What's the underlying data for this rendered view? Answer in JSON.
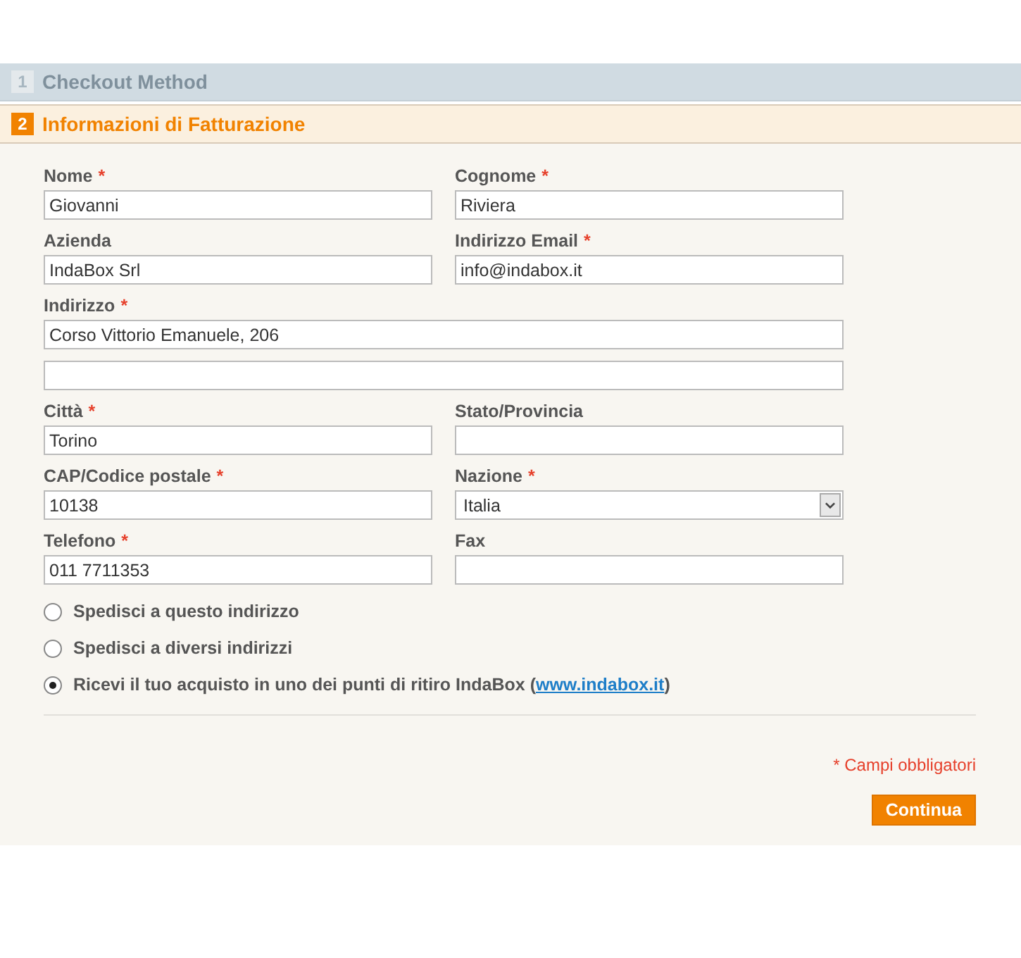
{
  "steps": [
    {
      "number": "1",
      "title": "Checkout Method",
      "selected": false
    },
    {
      "number": "2",
      "title": "Informazioni di Fatturazione",
      "selected": true
    }
  ],
  "form": {
    "rows": [
      [
        {
          "kind": "text",
          "label": "Nome",
          "required_mark": "*",
          "value": "Giovanni"
        },
        {
          "kind": "text",
          "label": "Cognome",
          "required_mark": "*",
          "value": "Riviera"
        }
      ],
      [
        {
          "kind": "text",
          "label": "Azienda",
          "value": "IndaBox Srl"
        },
        {
          "kind": "text",
          "label": "Indirizzo Email",
          "required_mark": "*",
          "value": "info@indabox.it"
        }
      ],
      [
        {
          "kind": "text",
          "label": "Indirizzo",
          "required_mark": "*",
          "value": "Corso Vittorio Emanuele, 206"
        }
      ],
      [
        {
          "kind": "text"
        }
      ],
      [
        {
          "kind": "text",
          "label": "Città",
          "required_mark": "*",
          "value": "Torino"
        },
        {
          "kind": "text",
          "label": "Stato/Provincia"
        }
      ],
      [
        {
          "kind": "text",
          "label": "CAP/Codice postale",
          "required_mark": "*",
          "value": "10138"
        },
        {
          "kind": "select",
          "label": "Nazione",
          "required_mark": "*",
          "value": "Italia"
        }
      ],
      [
        {
          "kind": "text",
          "label": "Telefono",
          "required_mark": "*",
          "value": "011 7711353"
        },
        {
          "kind": "text",
          "label": "Fax"
        }
      ]
    ],
    "shipping_options": [
      {
        "label": "Spedisci a questo indirizzo",
        "selected": false
      },
      {
        "label": "Spedisci a diversi indirizzi",
        "selected": false
      },
      {
        "label": "Ricevi il tuo acquisto in uno dei punti di ritiro IndaBox (",
        "link": "www.indabox.it",
        "label_after": ")",
        "selected": true
      }
    ],
    "required_note": "* Campi obbligatori",
    "button": "Continua"
  }
}
